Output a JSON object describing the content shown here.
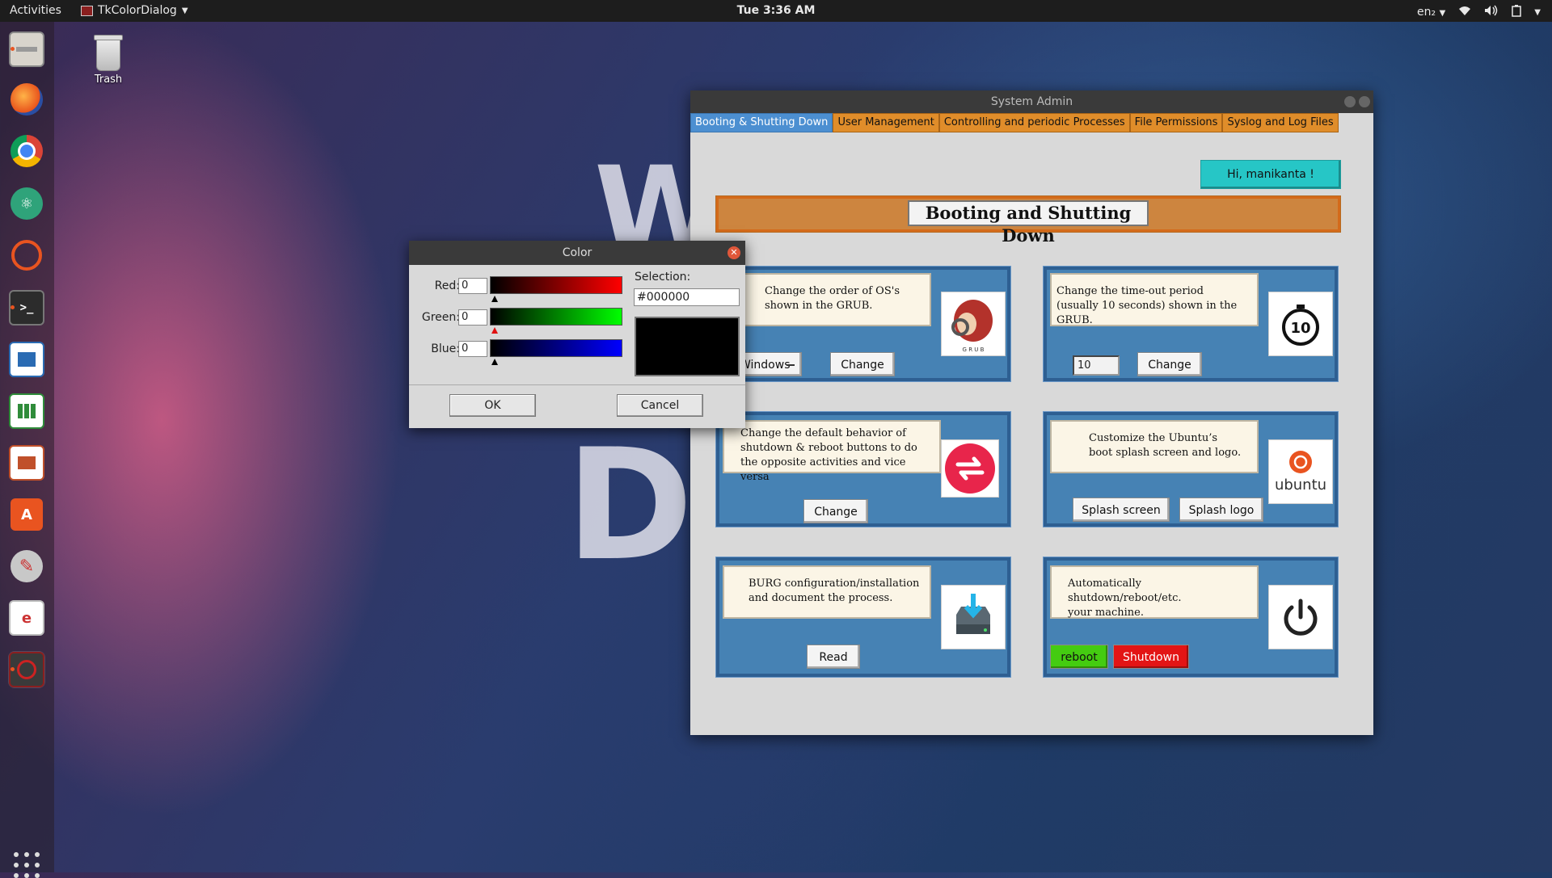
{
  "topbar": {
    "activities": "Activities",
    "app_name": "TkColorDialog",
    "clock": "Tue  3:36 AM",
    "language": "en₂"
  },
  "dock": {
    "items": [
      {
        "icon": "files-icon"
      },
      {
        "icon": "firefox-icon"
      },
      {
        "icon": "chrome-icon"
      },
      {
        "icon": "atom-icon"
      },
      {
        "icon": "ubuntu-software-updater-icon"
      },
      {
        "icon": "terminal-icon"
      },
      {
        "icon": "writer-icon"
      },
      {
        "icon": "calc-icon"
      },
      {
        "icon": "impress-icon"
      },
      {
        "icon": "software-center-icon"
      },
      {
        "icon": "settings-icon"
      },
      {
        "icon": "text-editor-icon"
      },
      {
        "icon": "tk-app-icon"
      }
    ]
  },
  "desktop": {
    "trash_label": "Trash",
    "bg_letters_1": "W",
    "bg_letters_2": "DR"
  },
  "admin": {
    "title": "System Admin",
    "tabs": [
      "Booting & Shutting Down",
      "User Management",
      "Controlling and periodic Processes",
      "File Permissions",
      "Syslog and Log Files"
    ],
    "active_tab": 0,
    "greeting": "Hi, manikanta !",
    "section_title": "Booting and Shutting Down",
    "cards": {
      "grub_order": {
        "text": "Change the order of OS's\nshown in the GRUB.",
        "select_value": "Windows",
        "button": "Change",
        "image_text": "G R U B"
      },
      "timeout": {
        "text": "Change the time-out period\n(usually 10 seconds) shown in the GRUB.",
        "input_value": "10",
        "button": "Change",
        "image_text": "10"
      },
      "behavior": {
        "text": "Change the default behavior of\nshutdown & reboot buttons to do\nthe opposite activities and vice versa",
        "button": "Change"
      },
      "splash": {
        "text": "Customize the Ubuntu’s\nboot splash screen and logo.",
        "button1": "Splash screen",
        "button2": "Splash logo",
        "image_text": "ubuntu"
      },
      "burg": {
        "text": "BURG configuration/installation\nand document the process.",
        "button": "Read"
      },
      "auto": {
        "text": "Automatically shutdown/reboot/etc.\nyour machine.",
        "button1": "reboot",
        "button2": "Shutdown"
      }
    }
  },
  "color_dialog": {
    "title": "Color",
    "red_label": "Red:",
    "green_label": "Green:",
    "blue_label": "Blue:",
    "red_value": "0",
    "green_value": "0",
    "blue_value": "0",
    "selection_label": "Selection:",
    "selection_value": "#000000",
    "ok": "OK",
    "cancel": "Cancel"
  },
  "colors": {
    "tab_active": "#4c8fd1",
    "tab": "#e08d2a",
    "greeting_bg": "#26c6c6",
    "banner": "#cd853f",
    "card": "#4682b4",
    "reboot": "#44cc11",
    "shutdown": "#e31515"
  }
}
